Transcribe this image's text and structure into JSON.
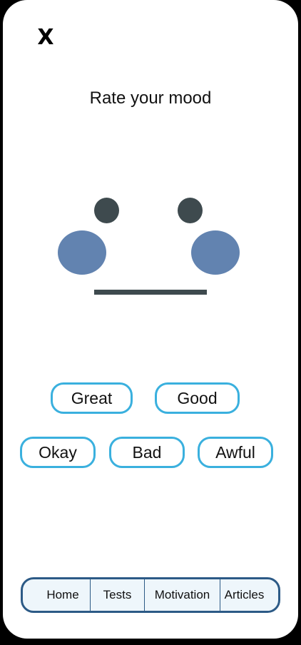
{
  "header": {
    "close_label": "X",
    "title": "Rate your mood"
  },
  "face": {
    "expression": "neutral",
    "eye_color": "#3e4a4e",
    "cheek_color": "#6283b0",
    "mouth_color": "#3e4a4e"
  },
  "mood_options": [
    {
      "label": "Great"
    },
    {
      "label": "Good"
    },
    {
      "label": "Okay"
    },
    {
      "label": "Bad"
    },
    {
      "label": "Awful"
    }
  ],
  "bottom_nav": {
    "items": [
      {
        "label": "Home"
      },
      {
        "label": "Tests"
      },
      {
        "label": "Motivation"
      },
      {
        "label": "Articles"
      }
    ]
  },
  "colors": {
    "accent": "#3ab0de",
    "nav_border": "#2c5a86",
    "nav_background": "#eef6fb"
  }
}
